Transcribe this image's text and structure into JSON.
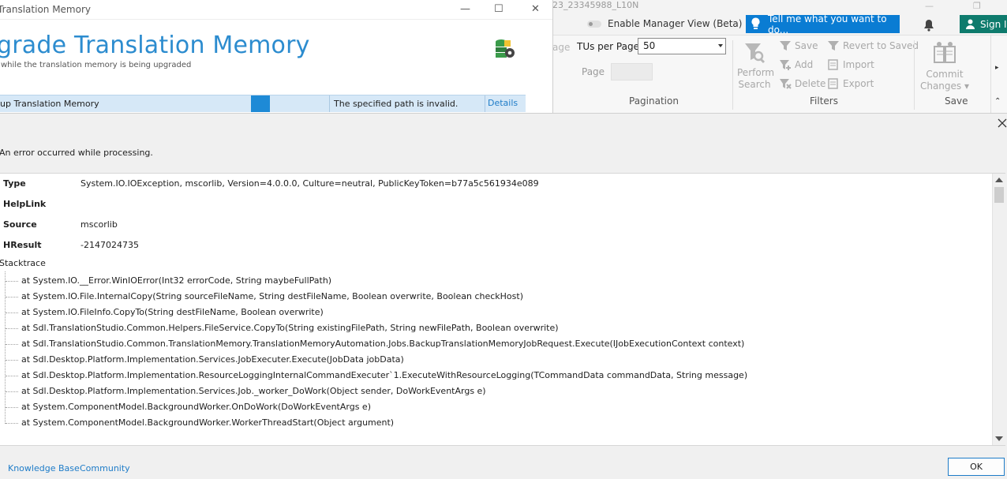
{
  "background_app": {
    "doc_title": "23_23345988_L10N",
    "manager_view_label": "Enable Manager View (Beta)",
    "tell_me_label": "Tell me what you want to do...",
    "sign_in_label": "Sign In",
    "ribbon": {
      "partial_label": "age",
      "tus_per_page_label": "TUs per Page:",
      "tus_per_page_value": "50",
      "page_label": "Page",
      "pagination_group": "Pagination",
      "perform_search_line1": "Perform",
      "perform_search_line2": "Search",
      "filters": {
        "save": "Save",
        "add": "Add",
        "delete": "Delete",
        "revert": "Revert to Saved",
        "import": "Import",
        "export": "Export",
        "group": "Filters"
      },
      "commit_line1": "Commit",
      "commit_line2": "Changes",
      "save_group": "Save"
    }
  },
  "upgrade_window": {
    "title": "Translation Memory",
    "heading": "grade Translation Memory",
    "subtitle": "while the translation memory is being upgraded",
    "task_name": "up Translation Memory",
    "task_message": "The specified path is invalid.",
    "details_link": "Details"
  },
  "error_dialog": {
    "message": "An error occurred while processing.",
    "properties": [
      {
        "key": "Type",
        "value": "System.IO.IOException, mscorlib, Version=4.0.0.0, Culture=neutral, PublicKeyToken=b77a5c561934e089"
      },
      {
        "key": "HelpLink",
        "value": ""
      },
      {
        "key": "Source",
        "value": "mscorlib"
      },
      {
        "key": "HResult",
        "value": "-2147024735"
      }
    ],
    "stacktrace_label": "Stacktrace",
    "stacktrace": [
      "at System.IO.__Error.WinIOError(Int32 errorCode, String maybeFullPath)",
      "at System.IO.File.InternalCopy(String sourceFileName, String destFileName, Boolean overwrite, Boolean checkHost)",
      "at System.IO.FileInfo.CopyTo(String destFileName, Boolean overwrite)",
      "at Sdl.TranslationStudio.Common.Helpers.FileService.CopyTo(String existingFilePath, String newFilePath, Boolean overwrite)",
      "at Sdl.TranslationStudio.Common.TranslationMemory.TranslationMemoryAutomation.Jobs.BackupTranslationMemoryJobRequest.Execute(IJobExecutionContext context)",
      "at Sdl.Desktop.Platform.Implementation.Services.JobExecuter.Execute(JobData jobData)",
      "at Sdl.Desktop.Platform.Implementation.ResourceLoggingInternalCommandExecuter`1.ExecuteWithResourceLogging(TCommandData commandData, String message)",
      "at Sdl.Desktop.Platform.Implementation.Services.Job._worker_DoWork(Object sender, DoWorkEventArgs e)",
      "at System.ComponentModel.BackgroundWorker.OnDoWork(DoWorkEventArgs e)",
      "at System.ComponentModel.BackgroundWorker.WorkerThreadStart(Object argument)"
    ],
    "footer": {
      "knowledge_base": "Knowledge Base",
      "community": "Community",
      "ok": "OK"
    }
  },
  "colors": {
    "accent_blue": "#1e7cc8",
    "heading_blue": "#2c8ccf",
    "tellme_blue": "#0a7cd3",
    "signin_green": "#0e7b6d",
    "row_highlight": "#d6e8f7"
  }
}
